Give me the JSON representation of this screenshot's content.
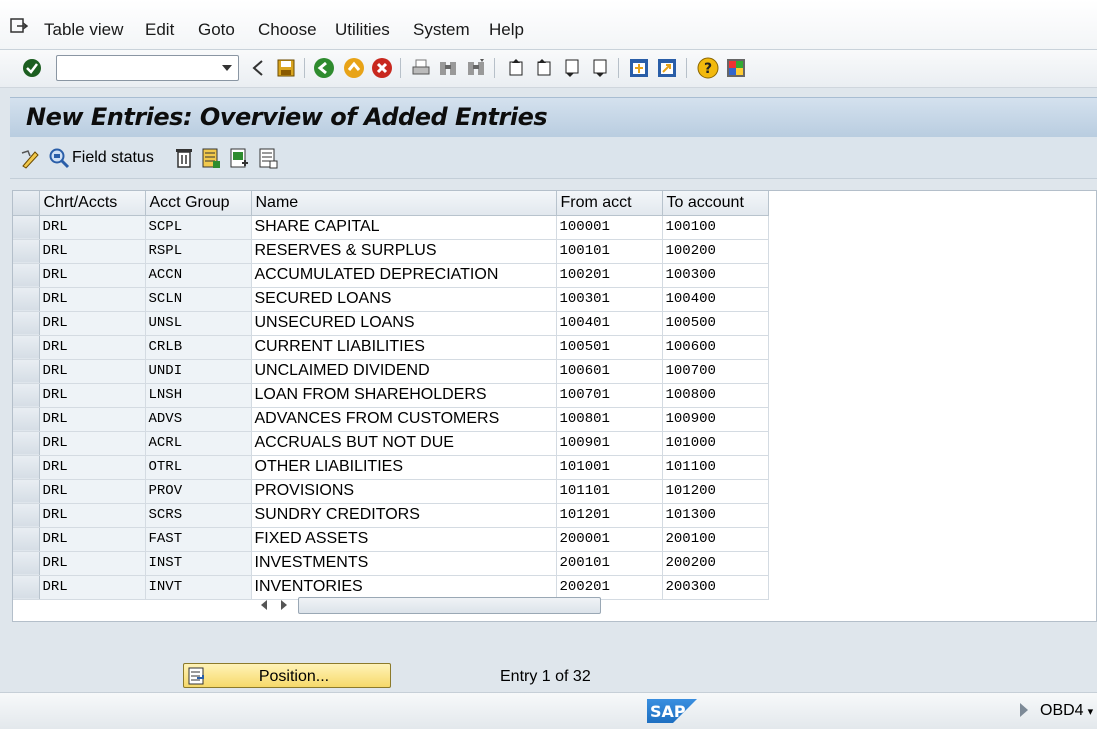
{
  "menubar": {
    "items": [
      "Table view",
      "Edit",
      "Goto",
      "Choose",
      "Utilities",
      "System",
      "Help"
    ]
  },
  "toolbar": {
    "command_field_value": "",
    "icons": [
      "enter-icon",
      "back-icon",
      "save-icon",
      "exit-icon",
      "cancel-icon",
      "print-icon",
      "find-icon",
      "find-next-icon",
      "first-page-icon",
      "previous-page-icon",
      "next-page-icon",
      "last-page-icon",
      "create-session-icon",
      "shortcut-icon",
      "help-icon",
      "layout-menu-icon"
    ]
  },
  "title": "New Entries: Overview of Added Entries",
  "app_toolbar": {
    "field_status_label": "Field status"
  },
  "table": {
    "headers": [
      "Chrt/Accts",
      "Acct Group",
      "Name",
      "From acct",
      "To account"
    ],
    "rows": [
      [
        "DRL",
        "SCPL",
        "SHARE CAPITAL",
        "100001",
        "100100"
      ],
      [
        "DRL",
        "RSPL",
        "RESERVES & SURPLUS",
        "100101",
        "100200"
      ],
      [
        "DRL",
        "ACCN",
        "ACCUMULATED DEPRECIATION",
        "100201",
        "100300"
      ],
      [
        "DRL",
        "SCLN",
        "SECURED LOANS",
        "100301",
        "100400"
      ],
      [
        "DRL",
        "UNSL",
        "UNSECURED LOANS",
        "100401",
        "100500"
      ],
      [
        "DRL",
        "CRLB",
        "CURRENT LIABILITIES",
        "100501",
        "100600"
      ],
      [
        "DRL",
        "UNDI",
        "UNCLAIMED DIVIDEND",
        "100601",
        "100700"
      ],
      [
        "DRL",
        "LNSH",
        "LOAN FROM SHAREHOLDERS",
        "100701",
        "100800"
      ],
      [
        "DRL",
        "ADVS",
        "ADVANCES FROM CUSTOMERS",
        "100801",
        "100900"
      ],
      [
        "DRL",
        "ACRL",
        "ACCRUALS BUT NOT DUE",
        "100901",
        "101000"
      ],
      [
        "DRL",
        "OTRL",
        "OTHER LIABILITIES",
        "101001",
        "101100"
      ],
      [
        "DRL",
        "PROV",
        "PROVISIONS",
        "101101",
        "101200"
      ],
      [
        "DRL",
        "SCRS",
        "SUNDRY CREDITORS",
        "101201",
        "101300"
      ],
      [
        "DRL",
        "FAST",
        "FIXED ASSETS",
        "200001",
        "200100"
      ],
      [
        "DRL",
        "INST",
        "INVESTMENTS",
        "200101",
        "200200"
      ],
      [
        "DRL",
        "INVT",
        "INVENTORIES",
        "200201",
        "200300"
      ]
    ]
  },
  "position_button": "Position...",
  "entry_info": "Entry 1 of 32",
  "status": {
    "logo_text": "SAP",
    "system": "OBD4"
  },
  "colors": {
    "title_bar": "#c5d6e7",
    "position_button": "#f6d96a",
    "sap_logo": "#1d6fc1"
  }
}
